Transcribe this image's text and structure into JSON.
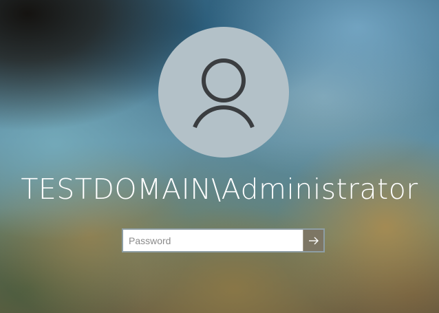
{
  "screen": {
    "type": "windows-lock-screen"
  },
  "user": {
    "avatar_icon": "user-silhouette-icon",
    "display_name": "TESTDOMAIN\\Administrator"
  },
  "password": {
    "placeholder": "Password",
    "value": "",
    "submit_icon": "arrow-right-icon"
  },
  "colors": {
    "avatar_bg": "#b3c1c8",
    "avatar_glyph": "#3a3d40",
    "submit_bg": "#7d7664",
    "input_border": "#8e9ea4",
    "username_text": "#ffffff"
  }
}
